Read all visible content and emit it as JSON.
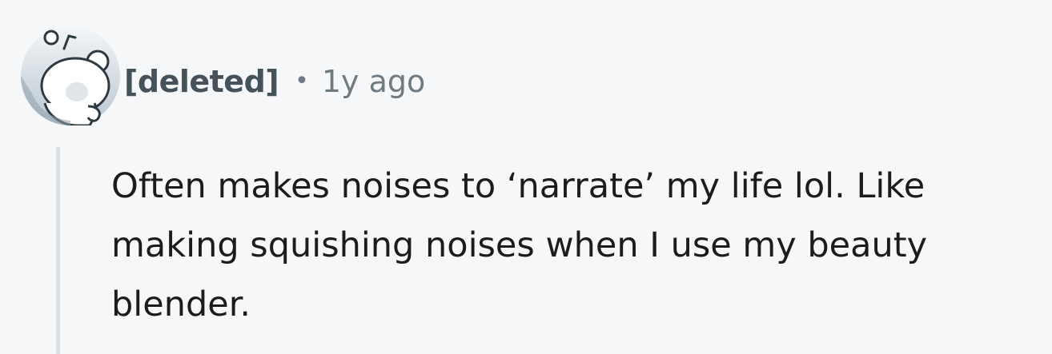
{
  "comment": {
    "avatar_icon": "reddit-snoo-avatar-icon",
    "author": "[deleted]",
    "separator": "•",
    "timestamp": "1y ago",
    "body": "Often makes noises to ‘narrate’ my life lol. Like making squishing noises when I use my beauty blender."
  },
  "colors": {
    "background": "#f6f7f8",
    "author": "#46525a",
    "meta": "#6f7b82",
    "body": "#1c1c1c",
    "thread_line": "#d8e0e6"
  }
}
